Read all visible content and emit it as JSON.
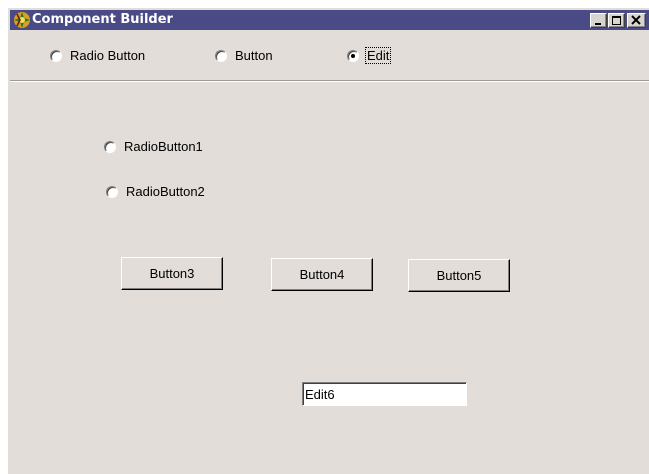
{
  "window": {
    "title": "Component Builder",
    "titlebar_color": "#4a4a86",
    "face_color": "#e2ddd8",
    "controls": [
      "minimize-icon",
      "maximize-icon",
      "close-icon"
    ]
  },
  "toolbar": {
    "options": [
      {
        "label": "Radio Button",
        "checked": false
      },
      {
        "label": "Button",
        "checked": false
      },
      {
        "label": "Edit",
        "checked": true
      }
    ]
  },
  "form": {
    "radios": [
      {
        "label": "RadioButton1",
        "checked": false
      },
      {
        "label": "RadioButton2",
        "checked": false
      }
    ],
    "buttons": [
      {
        "label": "Button3"
      },
      {
        "label": "Button4"
      },
      {
        "label": "Button5"
      }
    ],
    "edit": {
      "value": "Edit6"
    }
  }
}
